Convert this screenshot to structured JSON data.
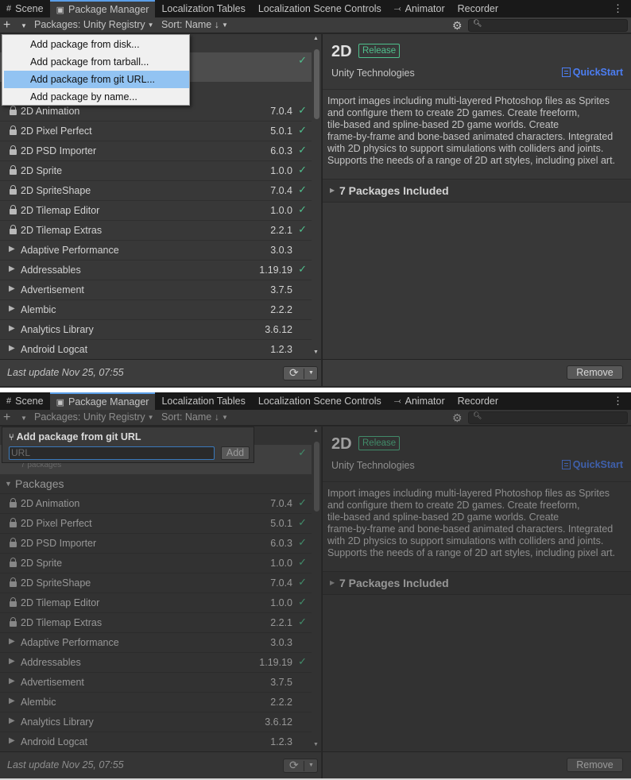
{
  "tabs": [
    {
      "label": "Scene",
      "icon": "grid-icon"
    },
    {
      "label": "Package Manager",
      "icon": "package-icon"
    },
    {
      "label": "Localization Tables",
      "icon": ""
    },
    {
      "label": "Localization Scene Controls",
      "icon": ""
    },
    {
      "label": "Animator",
      "icon": "animator-icon"
    },
    {
      "label": "Recorder",
      "icon": ""
    }
  ],
  "toolbar": {
    "add_symbol": "+",
    "packages_filter": "Packages: Unity Registry",
    "sort": "Sort: Name ↓"
  },
  "add_menu": {
    "items": [
      "Add package from disk...",
      "Add package from tarball...",
      "Add package from git URL...",
      "Add package by name..."
    ],
    "highlighted_index": 2
  },
  "git_popup": {
    "title": "Add package from git URL",
    "placeholder": "URL",
    "add_label": "Add",
    "behind_text": "7 packages"
  },
  "list": {
    "group_label": "Packages",
    "packages": [
      {
        "name": "2D Animation",
        "version": "7.0.4",
        "installed": true,
        "locked": true
      },
      {
        "name": "2D Pixel Perfect",
        "version": "5.0.1",
        "installed": true,
        "locked": true
      },
      {
        "name": "2D PSD Importer",
        "version": "6.0.3",
        "installed": true,
        "locked": true
      },
      {
        "name": "2D Sprite",
        "version": "1.0.0",
        "installed": true,
        "locked": true
      },
      {
        "name": "2D SpriteShape",
        "version": "7.0.4",
        "installed": true,
        "locked": true
      },
      {
        "name": "2D Tilemap Editor",
        "version": "1.0.0",
        "installed": true,
        "locked": true
      },
      {
        "name": "2D Tilemap Extras",
        "version": "2.2.1",
        "installed": true,
        "locked": true
      },
      {
        "name": "Adaptive Performance",
        "version": "3.0.3",
        "installed": false,
        "locked": false
      },
      {
        "name": "Addressables",
        "version": "1.19.19",
        "installed": true,
        "locked": false
      },
      {
        "name": "Advertisement",
        "version": "3.7.5",
        "installed": false,
        "locked": false
      },
      {
        "name": "Alembic",
        "version": "2.2.2",
        "installed": false,
        "locked": false
      },
      {
        "name": "Analytics Library",
        "version": "3.6.12",
        "installed": false,
        "locked": false
      },
      {
        "name": "Android Logcat",
        "version": "1.2.3",
        "installed": false,
        "locked": false
      }
    ]
  },
  "footer": {
    "status": "Last update Nov 25, 07:55",
    "remove_label": "Remove"
  },
  "details": {
    "title": "2D",
    "badge": "Release",
    "author": "Unity Technologies",
    "quickstart": "QuickStart",
    "description_lines": [
      "Import images including multi-layered Photoshop files as Sprites",
      "and configure them to create 2D games. Create freeform,",
      "tile-based and spline-based 2D game worlds. Create",
      "frame-by-frame and bone-based animated characters. Integrated",
      "with 2D physics to support simulations with colliders and joints.",
      "Supports the needs of a range of 2D art styles, including pixel art."
    ],
    "included": "7 Packages Included"
  },
  "colors": {
    "accent_blue": "#4c7ef3",
    "installed_green": "#4fc08d",
    "menu_highlight": "#92c3f2"
  }
}
